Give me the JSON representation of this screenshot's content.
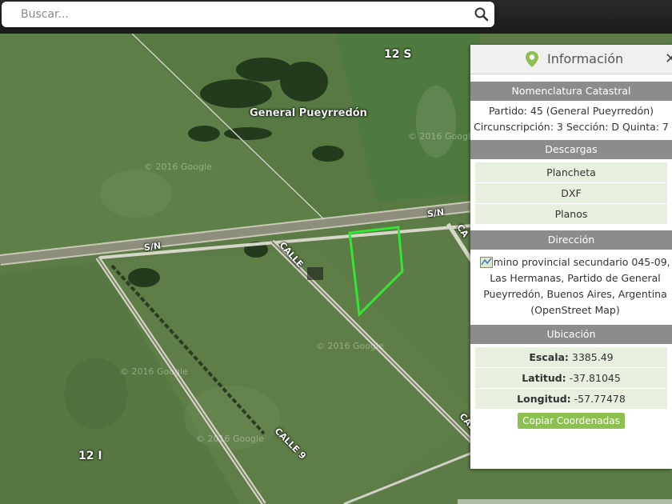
{
  "search": {
    "placeholder": "Buscar..."
  },
  "map": {
    "labels": {
      "town": "General Pueyrredón",
      "block_top": "12 S",
      "block_bottom": "12 I",
      "road_sn_1": "S/N",
      "road_sn_2": "S/N",
      "road_calle_a": "CALLE",
      "road_calle_b": "CALLE",
      "road_calle_9": "CALLE 9",
      "road_ca": "CA"
    },
    "watermark": "© 2016 Google"
  },
  "panel": {
    "title": "Información",
    "close": "✕",
    "cadastral": {
      "header": "Nomenclatura Catastral",
      "partido": "Partido: 45 (General Pueyrredón)",
      "details": "Circunscripción: 3 Sección: D Quinta: 7"
    },
    "downloads": {
      "header": "Descargas",
      "items": [
        "Plancheta",
        "DXF",
        "Planos"
      ]
    },
    "address": {
      "header": "Dirección",
      "text": "Camino provincial secundario 045-09, Las Hermanas, Partido de General Pueyrredón, Buenos Aires, Argentina (OpenStreet Map)"
    },
    "location": {
      "header": "Ubicación",
      "scale_label": "Escala:",
      "scale_value": "3385.49",
      "lat_label": "Latitud:",
      "lat_value": "-37.81045",
      "lon_label": "Longitud:",
      "lon_value": "-57.77478",
      "copy_button": "Copiar Coordenadas"
    }
  },
  "colors": {
    "parcel": "#33e633",
    "accent_green": "#8cc152",
    "header_gray": "#8c8c8c"
  },
  "icons": {
    "search": "search-icon",
    "pin": "map-pin-icon",
    "close": "close-icon",
    "osm": "osm-map-icon"
  }
}
